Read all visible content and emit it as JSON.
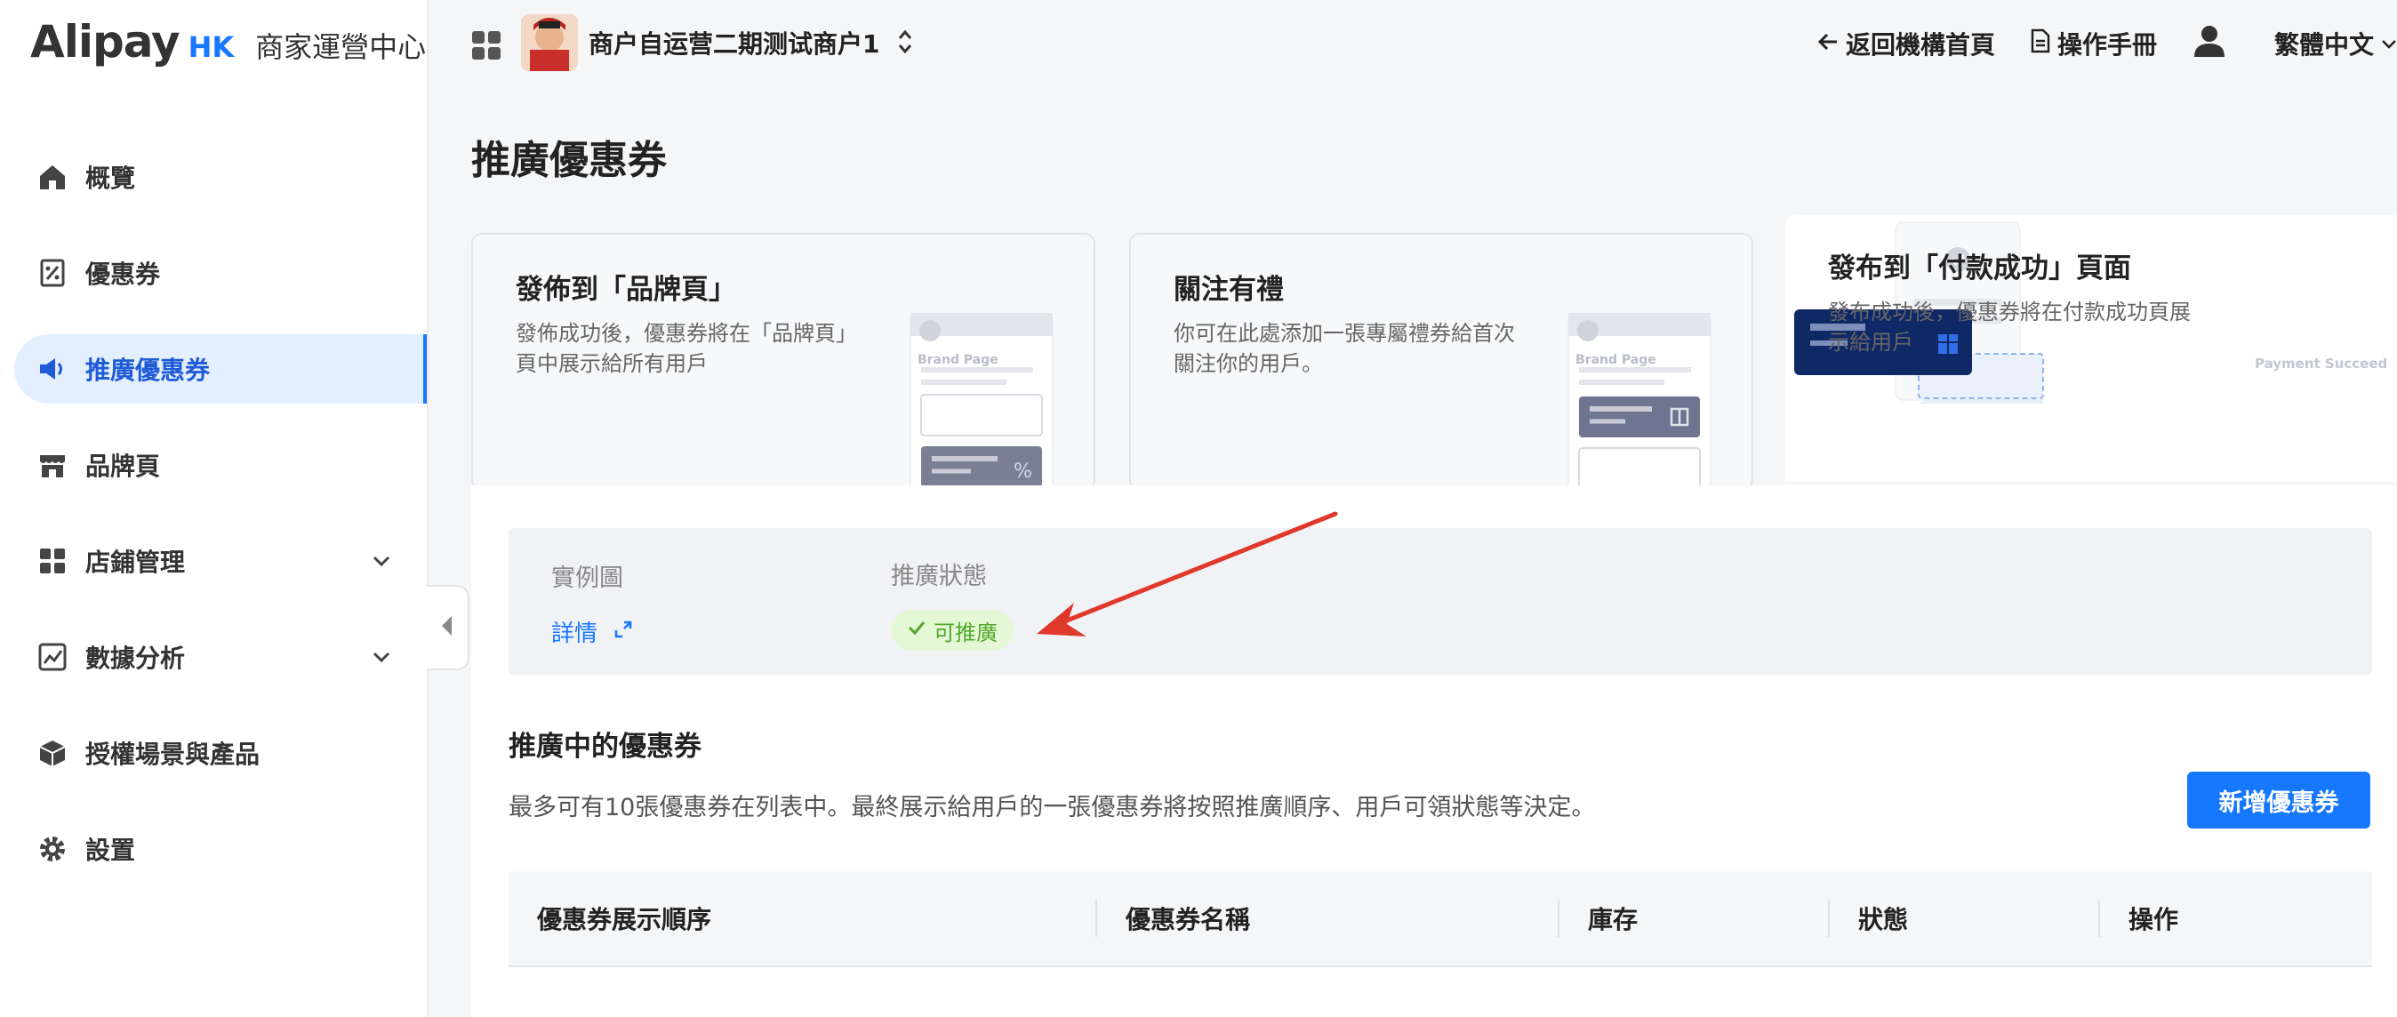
{
  "brand": {
    "name": "Alipay",
    "region": "HK",
    "subtitle": "商家運營中心"
  },
  "sidebar": {
    "items": [
      {
        "label": "概覽",
        "icon": "home-icon"
      },
      {
        "label": "優惠券",
        "icon": "coupon-icon"
      },
      {
        "label": "推廣優惠券",
        "icon": "megaphone-icon",
        "active": true
      },
      {
        "label": "品牌頁",
        "icon": "store-icon"
      },
      {
        "label": "店鋪管理",
        "icon": "grid-icon",
        "expandable": true
      },
      {
        "label": "數據分析",
        "icon": "chart-icon",
        "expandable": true
      },
      {
        "label": "授權場景與產品",
        "icon": "box-icon"
      },
      {
        "label": "設置",
        "icon": "gear-icon"
      }
    ]
  },
  "topbar": {
    "merchant_name": "商户自运营二期测试商户1",
    "back_label": "返回機構首頁",
    "manual_label": "操作手冊",
    "language": "繁體中文"
  },
  "page": {
    "title": "推廣優惠券"
  },
  "cards": [
    {
      "title": "發佈到「品牌頁」",
      "desc": "發佈成功後，優惠券將在「品牌頁」頁中展示給所有用戶",
      "ill_label": "Brand Page"
    },
    {
      "title": "關注有禮",
      "desc": "你可在此處添加一張專屬禮券給首次關注你的用戶。",
      "ill_label": "Brand Page"
    },
    {
      "title": "發布到「付款成功」頁面",
      "desc": "發布成功後，優惠券將在付款成功頁展示給用戶",
      "ill_label": "Payment Succeed"
    }
  ],
  "info": {
    "example_label": "實例圖",
    "detail_link": "詳情",
    "status_label": "推廣狀態",
    "status_badge": "可推廣"
  },
  "section": {
    "title": "推廣中的優惠券",
    "desc": "最多可有10張優惠券在列表中。最終展示給用戶的一張優惠券將按照推廣順序、用戶可領狀態等決定。",
    "add_button": "新增優惠券"
  },
  "table": {
    "columns": [
      "優惠券展示順序",
      "優惠券名稱",
      "庫存",
      "狀態",
      "操作"
    ]
  },
  "colors": {
    "accent": "#1677ff",
    "success": "#52a72c",
    "arrow": "#e0392b"
  }
}
